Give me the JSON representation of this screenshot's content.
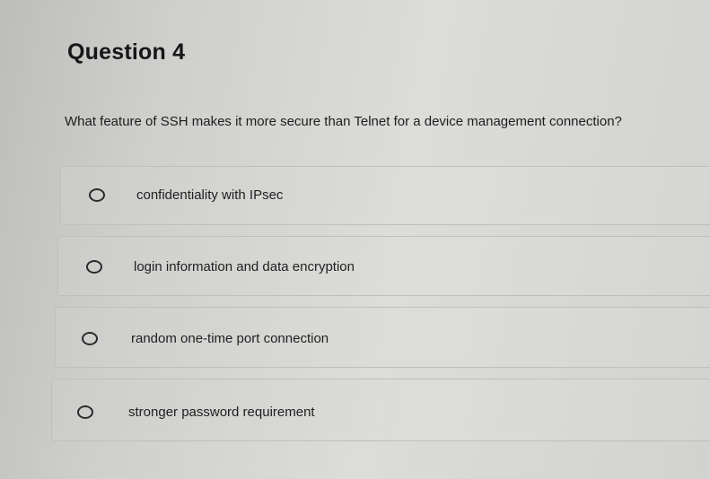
{
  "quiz": {
    "title": "Question 4",
    "question": "What feature of SSH makes it more secure than Telnet for a device management connection?",
    "options": [
      {
        "label": "confidentiality with IPsec"
      },
      {
        "label": "login information and data encryption"
      },
      {
        "label": "random one-time port connection"
      },
      {
        "label": "stronger password requirement"
      }
    ]
  }
}
